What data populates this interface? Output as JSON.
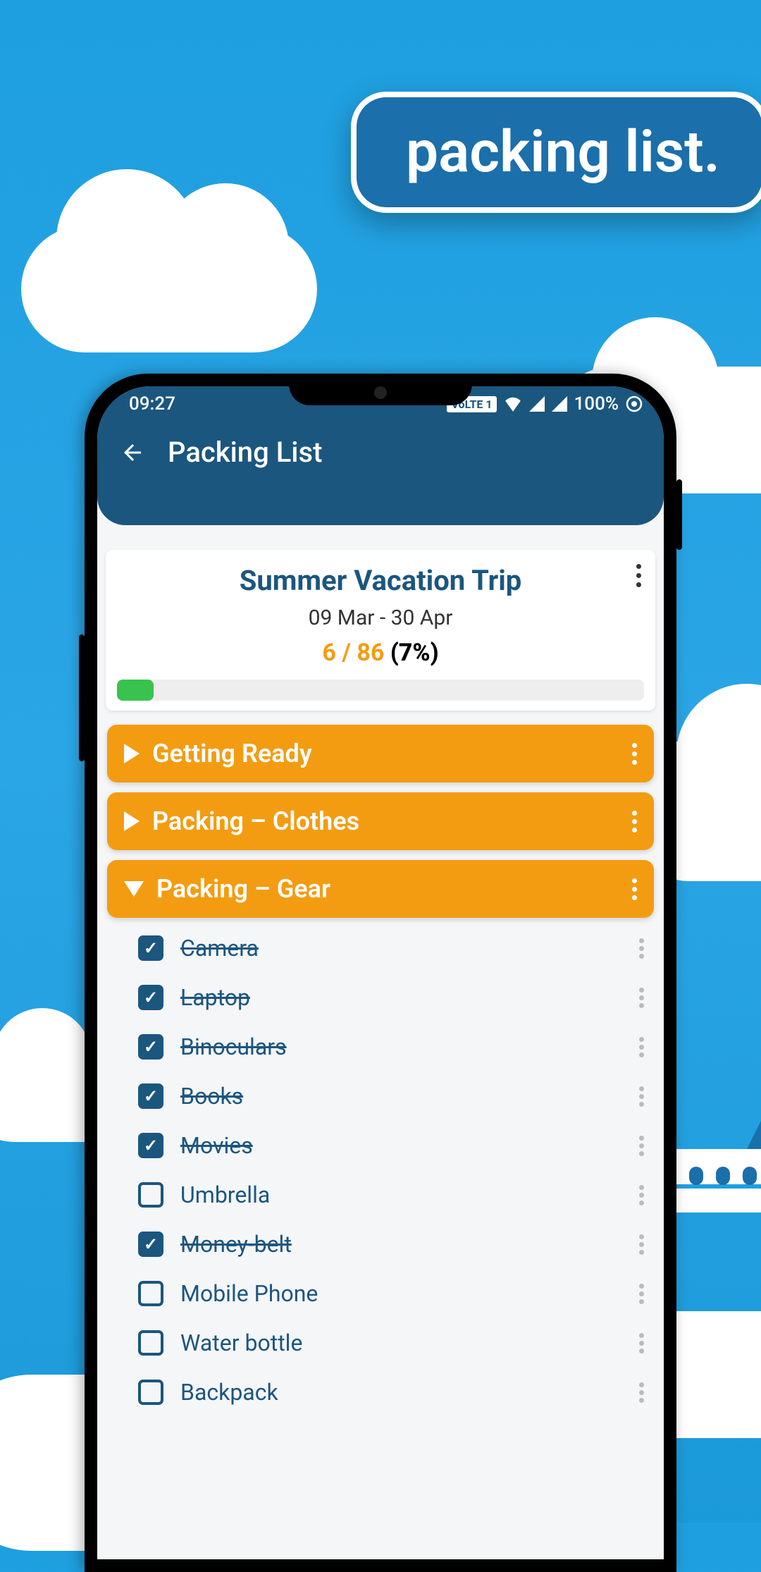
{
  "banner": {
    "text": "packing list."
  },
  "status_bar": {
    "time": "09:27",
    "volte": "VoLTE 1",
    "battery": "100%"
  },
  "app_bar": {
    "title": "Packing List"
  },
  "trip": {
    "title": "Summer Vacation Trip",
    "dates": "09 Mar - 30 Apr",
    "count": "6 / 86",
    "percent": "(7%)"
  },
  "categories": [
    {
      "label": "Getting Ready",
      "expanded": false
    },
    {
      "label": "Packing – Clothes",
      "expanded": false
    },
    {
      "label": "Packing – Gear",
      "expanded": true
    }
  ],
  "items": [
    {
      "label": "Camera",
      "checked": true
    },
    {
      "label": "Laptop",
      "checked": true
    },
    {
      "label": "Binoculars",
      "checked": true
    },
    {
      "label": "Books",
      "checked": true
    },
    {
      "label": "Movies",
      "checked": true
    },
    {
      "label": "Umbrella",
      "checked": false
    },
    {
      "label": "Money-belt",
      "checked": true
    },
    {
      "label": "Mobile Phone",
      "checked": false
    },
    {
      "label": "Water bottle",
      "checked": false
    },
    {
      "label": "Backpack",
      "checked": false
    }
  ]
}
